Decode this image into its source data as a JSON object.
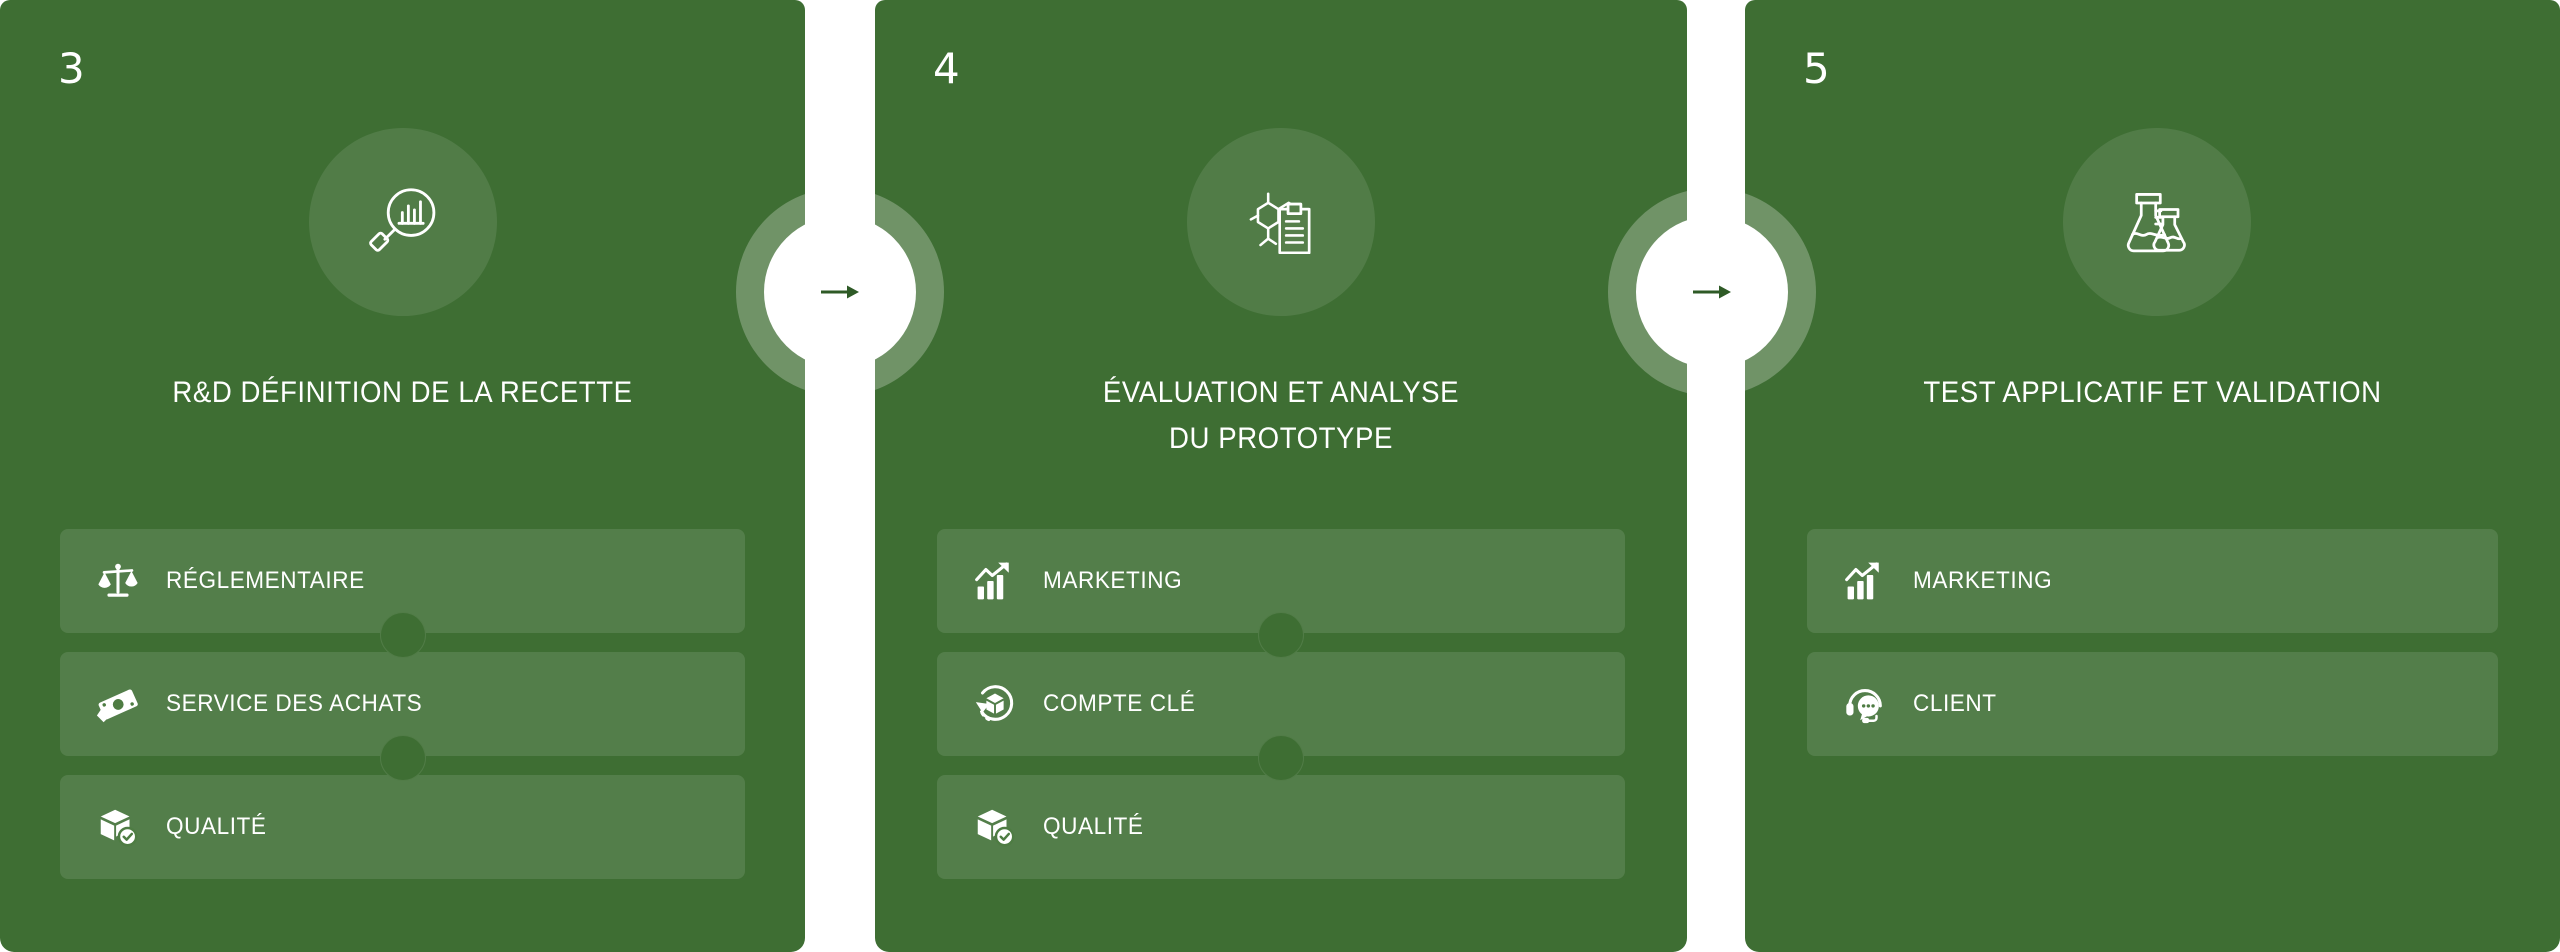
{
  "theme": {
    "card_green": "#3E6E33",
    "pill_green": "#4E7C43",
    "halo_green": "#567F4B",
    "arrow_color": "#2E5A26",
    "text_color": "#FFFFFF"
  },
  "cards": [
    {
      "number": "3",
      "icon": "magnifier-chart-icon",
      "title": "R&D DÉFINITION DE LA RECETTE",
      "items": [
        {
          "label": "RÉGLEMENTAIRE",
          "icon": "scales-icon"
        },
        {
          "label": "SERVICE DES ACHATS",
          "icon": "banknote-icon"
        },
        {
          "label": "QUALITÉ",
          "icon": "box-check-icon"
        }
      ]
    },
    {
      "number": "4",
      "icon": "molecule-clipboard-icon",
      "title": "ÉVALUATION ET ANALYSE\nDU PROTOTYPE",
      "items": [
        {
          "label": "MARKETING",
          "icon": "bar-chart-arrow-icon"
        },
        {
          "label": "COMPTE CLÉ",
          "icon": "box-rotate-icon"
        },
        {
          "label": "QUALITÉ",
          "icon": "box-check-icon"
        }
      ]
    },
    {
      "number": "5",
      "icon": "flasks-icon",
      "title": "TEST APPLICATIF ET VALIDATION",
      "items": [
        {
          "label": "MARKETING",
          "icon": "bar-chart-arrow-icon"
        },
        {
          "label": "CLIENT",
          "icon": "headset-chat-icon"
        }
      ]
    }
  ],
  "connectors": [
    {
      "icon": "arrow-right-icon"
    },
    {
      "icon": "arrow-right-icon"
    }
  ]
}
